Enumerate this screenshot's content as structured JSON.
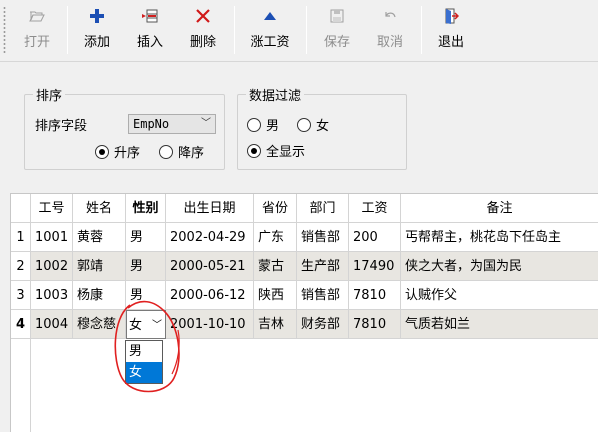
{
  "toolbar": {
    "buttons": [
      {
        "label": "打开",
        "icon": "folder-open-icon",
        "disabled": true
      },
      {
        "label": "添加",
        "icon": "plus-icon",
        "disabled": false
      },
      {
        "label": "插入",
        "icon": "insert-row-icon",
        "disabled": false
      },
      {
        "label": "删除",
        "icon": "delete-x-icon",
        "disabled": false
      },
      {
        "label": "涨工资",
        "icon": "up-triangle-icon",
        "disabled": false
      },
      {
        "label": "保存",
        "icon": "floppy-disk-icon",
        "disabled": true
      },
      {
        "label": "取消",
        "icon": "undo-icon",
        "disabled": true
      },
      {
        "label": "退出",
        "icon": "exit-door-icon",
        "disabled": false
      }
    ]
  },
  "sort_group": {
    "title": "排序",
    "field_label": "排序字段",
    "field_value": "EmpNo",
    "options": [
      {
        "label": "升序",
        "checked": true
      },
      {
        "label": "降序",
        "checked": false
      }
    ]
  },
  "filter_group": {
    "title": "数据过滤",
    "options": [
      {
        "label": "男",
        "checked": false
      },
      {
        "label": "女",
        "checked": false
      },
      {
        "label": "全显示",
        "checked": true
      }
    ]
  },
  "grid": {
    "columns": [
      "工号",
      "姓名",
      "性别",
      "出生日期",
      "省份",
      "部门",
      "工资",
      "备注"
    ],
    "rows": [
      {
        "num": "1",
        "cells": [
          "1001",
          "黄蓉",
          "男",
          "2002-04-29",
          "广东",
          "销售部",
          "200",
          "丐帮帮主，桃花岛下任岛主"
        ]
      },
      {
        "num": "2",
        "cells": [
          "1002",
          "郭靖",
          "男",
          "2000-05-21",
          "蒙古",
          "生产部",
          "17490",
          "侠之大者，为国为民"
        ]
      },
      {
        "num": "3",
        "cells": [
          "1003",
          "杨康",
          "男",
          "2000-06-12",
          "陕西",
          "销售部",
          "7810",
          "认贼作父"
        ]
      },
      {
        "num": "4",
        "cells": [
          "1004",
          "穆念慈",
          "女",
          "2001-10-10",
          "吉林",
          "财务部",
          "7810",
          "气质若如兰"
        ]
      }
    ],
    "editor_options": [
      "男",
      "女"
    ]
  },
  "colors": {
    "accent": "#0078d7",
    "row_alt": "#e8e6e1",
    "annotation": "#e02020"
  }
}
